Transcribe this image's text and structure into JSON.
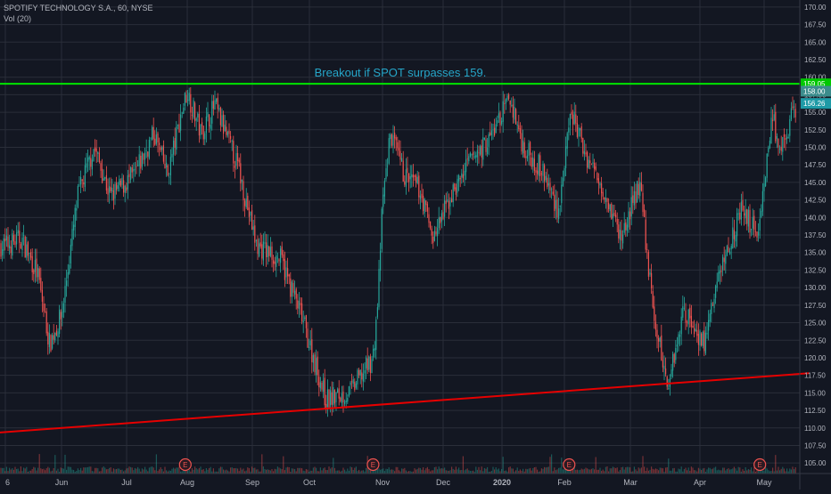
{
  "legend": {
    "symbol_line": "SPOTIFY TECHNOLOGY S.A., 60, NYSE",
    "volume_line": "Vol (20)"
  },
  "annotation": "Breakout if SPOT surpasses 159.",
  "price_labels": {
    "resistance_tag": "159.05",
    "current_tag_a": "158.00",
    "current_tag_b": "156.26"
  },
  "chart_data": {
    "type": "candlestick",
    "title": "SPOTIFY TECHNOLOGY S.A., 60, NYSE",
    "ylim": [
      103.5,
      171.0
    ],
    "y_ticks": [
      105,
      107.5,
      110,
      112.5,
      115,
      117.5,
      120,
      122.5,
      125,
      127.5,
      130,
      132.5,
      135,
      137.5,
      140,
      142.5,
      145,
      147.5,
      150,
      152.5,
      155,
      157.5,
      160,
      162.5,
      165,
      167.5,
      170
    ],
    "x_ticks": [
      {
        "label": "6",
        "date": "2019-05-06"
      },
      {
        "label": "Jun",
        "date": "2019-06-03"
      },
      {
        "label": "Jul",
        "date": "2019-07-01"
      },
      {
        "label": "Aug",
        "date": "2019-08-01"
      },
      {
        "label": "Sep",
        "date": "2019-09-03"
      },
      {
        "label": "Oct",
        "date": "2019-10-01"
      },
      {
        "label": "Nov",
        "date": "2019-11-01"
      },
      {
        "label": "Dec",
        "date": "2019-12-02"
      },
      {
        "label": "2020",
        "date": "2020-01-02"
      },
      {
        "label": "Feb",
        "date": "2020-02-03"
      },
      {
        "label": "Mar",
        "date": "2020-03-02"
      },
      {
        "label": "Apr",
        "date": "2020-04-01"
      },
      {
        "label": "May",
        "date": "2020-05-01"
      }
    ],
    "price_path": [
      {
        "date": "2019-05-06",
        "price": 136
      },
      {
        "date": "2019-05-14",
        "price": 137
      },
      {
        "date": "2019-05-22",
        "price": 132
      },
      {
        "date": "2019-05-28",
        "price": 122
      },
      {
        "date": "2019-06-03",
        "price": 126
      },
      {
        "date": "2019-06-10",
        "price": 143
      },
      {
        "date": "2019-06-17",
        "price": 150
      },
      {
        "date": "2019-06-24",
        "price": 143
      },
      {
        "date": "2019-07-05",
        "price": 146
      },
      {
        "date": "2019-07-15",
        "price": 152
      },
      {
        "date": "2019-07-22",
        "price": 146
      },
      {
        "date": "2019-07-29",
        "price": 155
      },
      {
        "date": "2019-08-01",
        "price": 158
      },
      {
        "date": "2019-08-08",
        "price": 152
      },
      {
        "date": "2019-08-15",
        "price": 156
      },
      {
        "date": "2019-08-27",
        "price": 147
      },
      {
        "date": "2019-09-05",
        "price": 136
      },
      {
        "date": "2019-09-17",
        "price": 134
      },
      {
        "date": "2019-09-27",
        "price": 126
      },
      {
        "date": "2019-10-08",
        "price": 114
      },
      {
        "date": "2019-10-18",
        "price": 115
      },
      {
        "date": "2019-10-28",
        "price": 120
      },
      {
        "date": "2019-10-30",
        "price": 128
      },
      {
        "date": "2019-11-01",
        "price": 142
      },
      {
        "date": "2019-11-05",
        "price": 152
      },
      {
        "date": "2019-11-12",
        "price": 146
      },
      {
        "date": "2019-11-20",
        "price": 144
      },
      {
        "date": "2019-11-27",
        "price": 137
      },
      {
        "date": "2019-12-06",
        "price": 143
      },
      {
        "date": "2019-12-16",
        "price": 148
      },
      {
        "date": "2019-12-26",
        "price": 151
      },
      {
        "date": "2020-01-06",
        "price": 157
      },
      {
        "date": "2020-01-13",
        "price": 150
      },
      {
        "date": "2020-01-22",
        "price": 147
      },
      {
        "date": "2020-01-31",
        "price": 141
      },
      {
        "date": "2020-02-06",
        "price": 155
      },
      {
        "date": "2020-02-12",
        "price": 149
      },
      {
        "date": "2020-02-20",
        "price": 144
      },
      {
        "date": "2020-02-27",
        "price": 137
      },
      {
        "date": "2020-03-06",
        "price": 145
      },
      {
        "date": "2020-03-12",
        "price": 126
      },
      {
        "date": "2020-03-18",
        "price": 116
      },
      {
        "date": "2020-03-25",
        "price": 127
      },
      {
        "date": "2020-04-03",
        "price": 122
      },
      {
        "date": "2020-04-10",
        "price": 132
      },
      {
        "date": "2020-04-20",
        "price": 141
      },
      {
        "date": "2020-04-28",
        "price": 138
      },
      {
        "date": "2020-05-01",
        "price": 145
      },
      {
        "date": "2020-05-05",
        "price": 155
      },
      {
        "date": "2020-05-08",
        "price": 148
      },
      {
        "date": "2020-05-15",
        "price": 156
      },
      {
        "date": "2020-05-20",
        "price": 150
      }
    ],
    "resistance_line": {
      "value": 159.05,
      "color": "#00e600"
    },
    "support_trendline": {
      "color": "#e60000",
      "points": [
        {
          "date": "2019-05-01",
          "price": 109.3
        },
        {
          "date": "2020-05-22",
          "price": 117.8
        }
      ]
    },
    "earnings_markers": [
      {
        "label": "E",
        "date": "2019-07-31"
      },
      {
        "label": "E",
        "date": "2019-10-28"
      },
      {
        "label": "E",
        "date": "2020-02-05"
      },
      {
        "label": "E",
        "date": "2020-04-29"
      }
    ],
    "colors": {
      "background": "#131722",
      "grid": "#2a2e39",
      "up": "#26a69a",
      "down": "#ef5350",
      "axis_text": "#b2b5be",
      "annotation": "#26a6c9",
      "tag_a": "#3b8c8c",
      "tag_b": "#1e9aa6",
      "earnings_marker": "#ef5350"
    }
  }
}
